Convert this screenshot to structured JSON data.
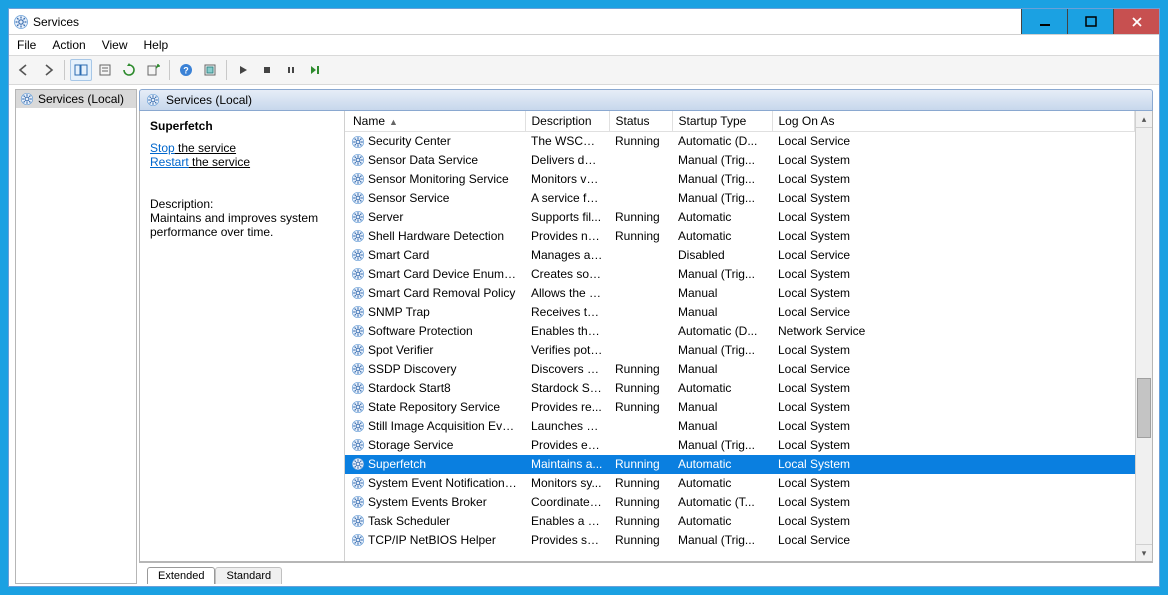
{
  "window": {
    "title": "Services"
  },
  "menu": {
    "file": "File",
    "action": "Action",
    "view": "View",
    "help": "Help"
  },
  "tree": {
    "root": "Services (Local)"
  },
  "pane_header": "Services (Local)",
  "info": {
    "selected_name": "Superfetch",
    "stop_link": "Stop",
    "stop_suffix": " the service",
    "restart_link": "Restart",
    "restart_suffix": " the service",
    "desc_label": "Description:",
    "desc_text": "Maintains and improves system performance over time."
  },
  "columns": {
    "name": "Name",
    "description": "Description",
    "status": "Status",
    "startup": "Startup Type",
    "logon": "Log On As"
  },
  "rows": [
    {
      "name": "Security Center",
      "desc": "The WSCSV...",
      "status": "Running",
      "startup": "Automatic (D...",
      "logon": "Local Service",
      "sel": false
    },
    {
      "name": "Sensor Data Service",
      "desc": "Delivers dat...",
      "status": "",
      "startup": "Manual (Trig...",
      "logon": "Local System",
      "sel": false
    },
    {
      "name": "Sensor Monitoring Service",
      "desc": "Monitors va...",
      "status": "",
      "startup": "Manual (Trig...",
      "logon": "Local System",
      "sel": false
    },
    {
      "name": "Sensor Service",
      "desc": "A service fo...",
      "status": "",
      "startup": "Manual (Trig...",
      "logon": "Local System",
      "sel": false
    },
    {
      "name": "Server",
      "desc": "Supports fil...",
      "status": "Running",
      "startup": "Automatic",
      "logon": "Local System",
      "sel": false
    },
    {
      "name": "Shell Hardware Detection",
      "desc": "Provides no...",
      "status": "Running",
      "startup": "Automatic",
      "logon": "Local System",
      "sel": false
    },
    {
      "name": "Smart Card",
      "desc": "Manages ac...",
      "status": "",
      "startup": "Disabled",
      "logon": "Local Service",
      "sel": false
    },
    {
      "name": "Smart Card Device Enumera...",
      "desc": "Creates soft...",
      "status": "",
      "startup": "Manual (Trig...",
      "logon": "Local System",
      "sel": false
    },
    {
      "name": "Smart Card Removal Policy",
      "desc": "Allows the s...",
      "status": "",
      "startup": "Manual",
      "logon": "Local System",
      "sel": false
    },
    {
      "name": "SNMP Trap",
      "desc": "Receives tra...",
      "status": "",
      "startup": "Manual",
      "logon": "Local Service",
      "sel": false
    },
    {
      "name": "Software Protection",
      "desc": "Enables the ...",
      "status": "",
      "startup": "Automatic (D...",
      "logon": "Network Service",
      "sel": false
    },
    {
      "name": "Spot Verifier",
      "desc": "Verifies pote...",
      "status": "",
      "startup": "Manual (Trig...",
      "logon": "Local System",
      "sel": false
    },
    {
      "name": "SSDP Discovery",
      "desc": "Discovers n...",
      "status": "Running",
      "startup": "Manual",
      "logon": "Local Service",
      "sel": false
    },
    {
      "name": "Stardock Start8",
      "desc": "Stardock St...",
      "status": "Running",
      "startup": "Automatic",
      "logon": "Local System",
      "sel": false
    },
    {
      "name": "State Repository Service",
      "desc": "Provides re...",
      "status": "Running",
      "startup": "Manual",
      "logon": "Local System",
      "sel": false
    },
    {
      "name": "Still Image Acquisition Events",
      "desc": "Launches a...",
      "status": "",
      "startup": "Manual",
      "logon": "Local System",
      "sel": false
    },
    {
      "name": "Storage Service",
      "desc": "Provides en...",
      "status": "",
      "startup": "Manual (Trig...",
      "logon": "Local System",
      "sel": false
    },
    {
      "name": "Superfetch",
      "desc": "Maintains a...",
      "status": "Running",
      "startup": "Automatic",
      "logon": "Local System",
      "sel": true
    },
    {
      "name": "System Event Notification S...",
      "desc": "Monitors sy...",
      "status": "Running",
      "startup": "Automatic",
      "logon": "Local System",
      "sel": false
    },
    {
      "name": "System Events Broker",
      "desc": "Coordinates...",
      "status": "Running",
      "startup": "Automatic (T...",
      "logon": "Local System",
      "sel": false
    },
    {
      "name": "Task Scheduler",
      "desc": "Enables a us...",
      "status": "Running",
      "startup": "Automatic",
      "logon": "Local System",
      "sel": false
    },
    {
      "name": "TCP/IP NetBIOS Helper",
      "desc": "Provides su...",
      "status": "Running",
      "startup": "Manual (Trig...",
      "logon": "Local Service",
      "sel": false
    }
  ],
  "tabs": {
    "extended": "Extended",
    "standard": "Standard"
  }
}
